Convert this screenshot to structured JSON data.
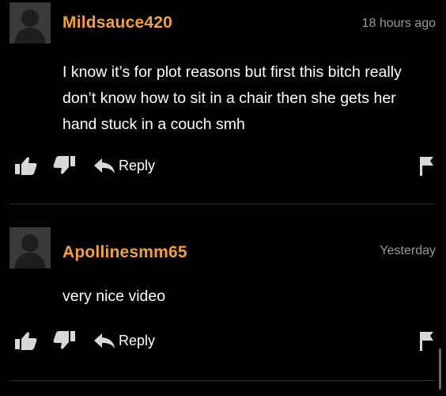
{
  "comments": [
    {
      "username": "Mildsauce420",
      "timestamp": "18 hours ago",
      "text": "I know it’s for plot reasons but first this bitch really don’t know how to sit in a chair then she gets her hand stuck in a couch smh",
      "reply_label": "Reply"
    },
    {
      "username": "Apollinesmm65",
      "timestamp": "Yesterday",
      "text": "very nice video",
      "reply_label": "Reply"
    }
  ],
  "icons": {
    "avatar": "default-user-silhouette-icon",
    "like": "thumbs-up-icon",
    "dislike": "thumbs-down-icon",
    "reply": "reply-arrow-icon",
    "flag": "flag-icon"
  },
  "colors": {
    "background": "#000000",
    "username": "#f0a041",
    "timestamp": "#9a9a9a",
    "text": "#ffffff",
    "avatar_bg": "#3a3a3a"
  }
}
